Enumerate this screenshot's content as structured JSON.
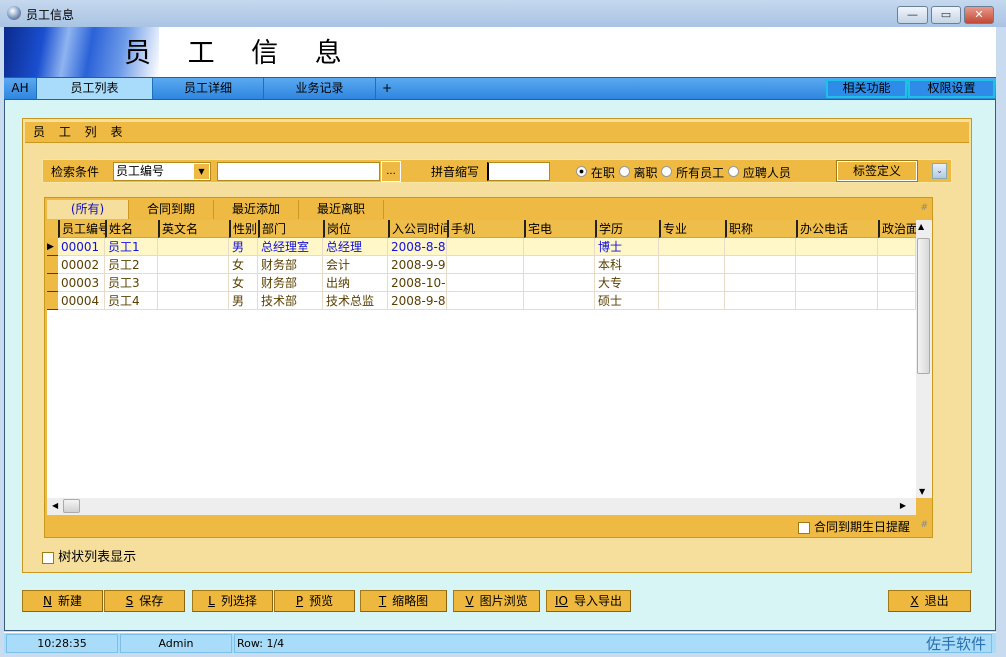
{
  "window": {
    "title": "员工信息",
    "minimize": "—",
    "maximize": "▭",
    "close": "✕"
  },
  "banner": {
    "title": "员 工 信 息"
  },
  "top_tabs": [
    {
      "label": "AH"
    },
    {
      "label": "员工列表"
    },
    {
      "label": "员工详细"
    },
    {
      "label": "业务记录"
    },
    {
      "label": "+"
    }
  ],
  "top_actions": {
    "related": "相关功能",
    "permissions": "权限设置"
  },
  "panel": {
    "title": "员 工 列 表"
  },
  "search": {
    "label": "检索条件",
    "field": "员工编号",
    "value": "",
    "browse": "...",
    "pinyin_label": "拼音缩写",
    "pinyin_value": "",
    "radios": [
      {
        "label": "在职",
        "checked": true
      },
      {
        "label": "离职",
        "checked": false
      },
      {
        "label": "所有员工",
        "checked": false
      },
      {
        "label": "应聘人员",
        "checked": false
      }
    ],
    "tag_button": "标签定义"
  },
  "grid": {
    "tabs": [
      "(所有)",
      "合同到期",
      "最近添加",
      "最近离职"
    ],
    "columns": [
      "员工编号",
      "姓名",
      "英文名",
      "性别",
      "部门",
      "岗位",
      "入公司时间",
      "手机",
      "宅电",
      "学历",
      "专业",
      "职称",
      "办公电话",
      "政治面貌"
    ],
    "rows": [
      [
        "00001",
        "员工1",
        "",
        "男",
        "总经理室",
        "总经理",
        "2008-8-8",
        "",
        "",
        "博士",
        "",
        "",
        "",
        ""
      ],
      [
        "00002",
        "员工2",
        "",
        "女",
        "财务部",
        "会计",
        "2008-9-9",
        "",
        "",
        "本科",
        "",
        "",
        "",
        ""
      ],
      [
        "00003",
        "员工3",
        "",
        "女",
        "财务部",
        "出纳",
        "2008-10-",
        "",
        "",
        "大专",
        "",
        "",
        "",
        ""
      ],
      [
        "00004",
        "员工4",
        "",
        "男",
        "技术部",
        "技术总监",
        "2008-9-8",
        "",
        "",
        "硕士",
        "",
        "",
        "",
        ""
      ]
    ],
    "reminder": "合同到期生日提醒"
  },
  "tree_view": "树状列表显示",
  "buttons": [
    {
      "key": "N",
      "label": "新建"
    },
    {
      "key": "S",
      "label": "保存"
    },
    {
      "key": "L",
      "label": "列选择"
    },
    {
      "key": "P",
      "label": "预览"
    },
    {
      "key": "T",
      "label": "缩略图"
    },
    {
      "key": "V",
      "label": "图片浏览"
    },
    {
      "key": "IO",
      "label": "导入导出"
    },
    {
      "key": "X",
      "label": "退出"
    }
  ],
  "status": {
    "time": "10:28:35",
    "user": "Admin",
    "row": "Row: 1/4",
    "brand": "佐手软件"
  }
}
